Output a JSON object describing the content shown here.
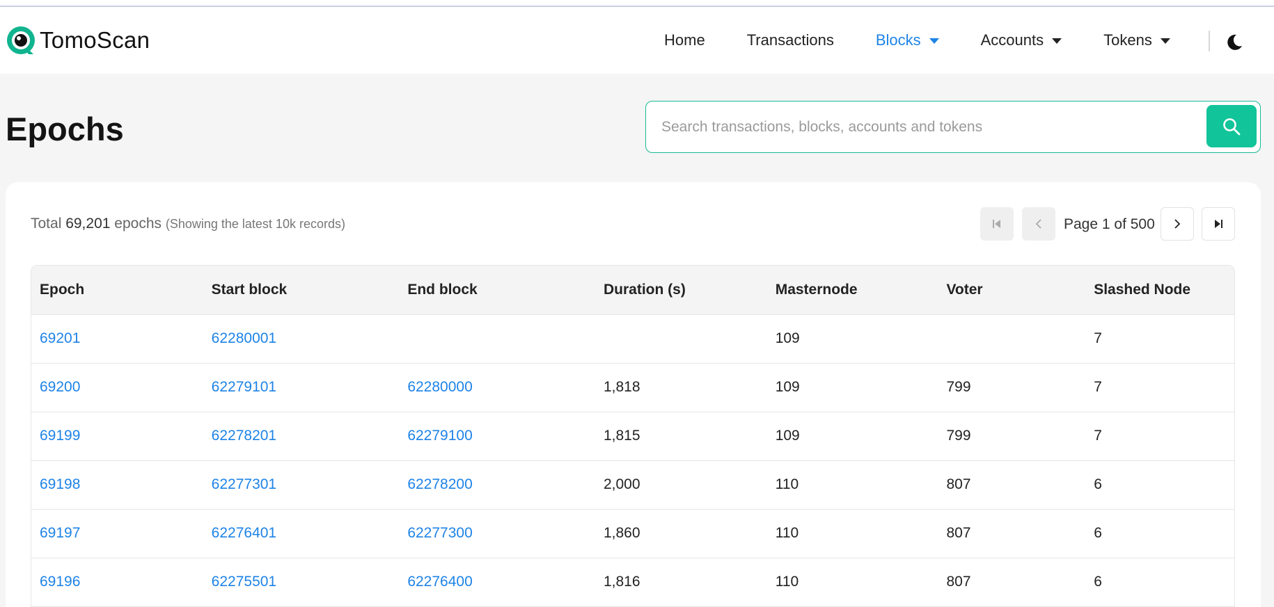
{
  "header": {
    "logo_text": "TomoScan",
    "nav": [
      {
        "label": "Home",
        "dropdown": false,
        "active": false
      },
      {
        "label": "Transactions",
        "dropdown": false,
        "active": false
      },
      {
        "label": "Blocks",
        "dropdown": true,
        "active": true
      },
      {
        "label": "Accounts",
        "dropdown": true,
        "active": false
      },
      {
        "label": "Tokens",
        "dropdown": true,
        "active": false
      }
    ],
    "theme_toggle_icon": "moon-icon"
  },
  "page": {
    "title": "Epochs"
  },
  "search": {
    "placeholder": "Search transactions, blocks, accounts and tokens",
    "value": "",
    "button_icon": "search-icon"
  },
  "summary": {
    "total_prefix": "Total",
    "total_count": "69,201",
    "total_suffix": "epochs",
    "note": "(Showing the latest 10k records)"
  },
  "pagination": {
    "label": "Page 1 of 500",
    "first_icon": "first-page-icon",
    "prev_icon": "chevron-left-icon",
    "next_icon": "chevron-right-icon",
    "last_icon": "last-page-icon"
  },
  "table": {
    "columns": [
      "Epoch",
      "Start block",
      "End block",
      "Duration (s)",
      "Masternode",
      "Voter",
      "Slashed Node"
    ],
    "rows": [
      {
        "epoch": "69201",
        "start_block": "62280001",
        "end_block": "",
        "duration": "",
        "masternode": "109",
        "voter": "",
        "slashed": "7"
      },
      {
        "epoch": "69200",
        "start_block": "62279101",
        "end_block": "62280000",
        "duration": "1,818",
        "masternode": "109",
        "voter": "799",
        "slashed": "7"
      },
      {
        "epoch": "69199",
        "start_block": "62278201",
        "end_block": "62279100",
        "duration": "1,815",
        "masternode": "109",
        "voter": "799",
        "slashed": "7"
      },
      {
        "epoch": "69198",
        "start_block": "62277301",
        "end_block": "62278200",
        "duration": "2,000",
        "masternode": "110",
        "voter": "807",
        "slashed": "6"
      },
      {
        "epoch": "69197",
        "start_block": "62276401",
        "end_block": "62277300",
        "duration": "1,860",
        "masternode": "110",
        "voter": "807",
        "slashed": "6"
      },
      {
        "epoch": "69196",
        "start_block": "62275501",
        "end_block": "62276400",
        "duration": "1,816",
        "masternode": "110",
        "voter": "807",
        "slashed": "6"
      }
    ]
  },
  "colors": {
    "accent": "#12c49a",
    "link": "#1d83e6",
    "page_bg": "#f5f5f5"
  }
}
